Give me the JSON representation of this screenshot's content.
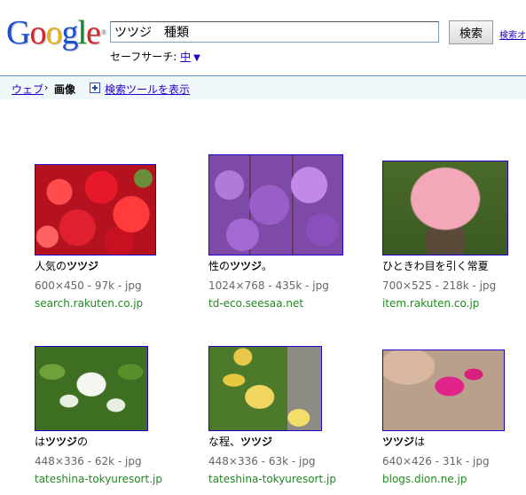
{
  "header": {
    "logo_text": "Google",
    "search_value": "ツツジ　種類",
    "search_button": "検索",
    "options_link": "検索オ",
    "safesearch_label": "セーフサーチ: ",
    "safesearch_level": "中",
    "safesearch_arrow": "▼"
  },
  "nav": {
    "web": "ウェブ",
    "separator": "›",
    "images": "画像",
    "show_tools": "検索ツールを表示"
  },
  "results": [
    {
      "caption_pre": "人気の",
      "caption_bold": "ツツジ",
      "caption_post": "",
      "meta": "600×450 - 97k - jpg",
      "site": "search.rakuten.co.jp"
    },
    {
      "caption_pre": "性の",
      "caption_bold": "ツツジ",
      "caption_post": "。",
      "meta": "1024×768 - 435k - jpg",
      "site": "td-eco.seesaa.net"
    },
    {
      "caption_pre": "ひときわ目を引く常夏",
      "caption_bold": "",
      "caption_post": "",
      "meta": "700×525 - 218k - jpg",
      "site": "item.rakuten.co.jp"
    },
    {
      "caption_pre": "は",
      "caption_bold": "ツツジ",
      "caption_post": "の",
      "meta": "448×336 - 62k - jpg",
      "site": "tateshina-tokyuresort.jp"
    },
    {
      "caption_pre": "な程、",
      "caption_bold": "ツツジ",
      "caption_post": "",
      "meta": "448×336 - 63k - jpg",
      "site": "tateshina-tokyuresort.jp"
    },
    {
      "caption_pre": "",
      "caption_bold": "ツツジ",
      "caption_post": "は",
      "meta": "640×426 - 31k - jpg",
      "site": "blogs.dion.ne.jp"
    }
  ]
}
